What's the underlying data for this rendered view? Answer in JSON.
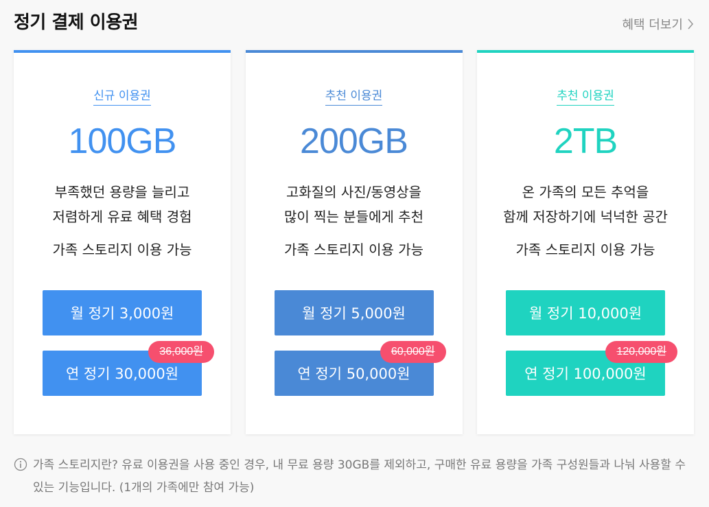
{
  "header": {
    "title": "정기 결제 이용권",
    "more_label": "혜택 더보기"
  },
  "cards": [
    {
      "badge": "신규 이용권",
      "capacity": "100GB",
      "desc_line1": "부족했던 용량을 늘리고",
      "desc_line2": "저렴하게 유료 혜택 경험",
      "family": "가족 스토리지 이용 가능",
      "monthly_label": "월 정기 3,000원",
      "yearly_label": "연 정기 30,000원",
      "original_price": "36,000원",
      "accent_color": "#4191f0",
      "button_color": "#4191f0"
    },
    {
      "badge": "추천 이용권",
      "capacity": "200GB",
      "desc_line1": "고화질의 사진/동영상을",
      "desc_line2": "많이 찍는 분들에게 추천",
      "family": "가족 스토리지 이용 가능",
      "monthly_label": "월 정기 5,000원",
      "yearly_label": "연 정기 50,000원",
      "original_price": "60,000원",
      "accent_color": "#4a89d6",
      "button_color": "#4a89d6"
    },
    {
      "badge": "추천 이용권",
      "capacity": "2TB",
      "desc_line1": "온 가족의 모든 추억을",
      "desc_line2": "함께 저장하기에 넉넉한 공간",
      "family": "가족 스토리지 이용 가능",
      "monthly_label": "월 정기 10,000원",
      "yearly_label": "연 정기 100,000원",
      "original_price": "120,000원",
      "accent_color": "#1fd3c0",
      "button_color": "#1fd3c0"
    }
  ],
  "notice": {
    "text": "가족 스토리지란? 유료 이용권을 사용 중인 경우, 내 무료 용량 30GB를 제외하고, 구매한 유료 용량을 가족 구성원들과 나눠 사용할 수 있는 기능입니다. (1개의 가족에만 참여 가능)",
    "icon": "info-icon"
  },
  "colors": {
    "tag_red": "#f64f6e",
    "background": "#f8f8f8"
  }
}
